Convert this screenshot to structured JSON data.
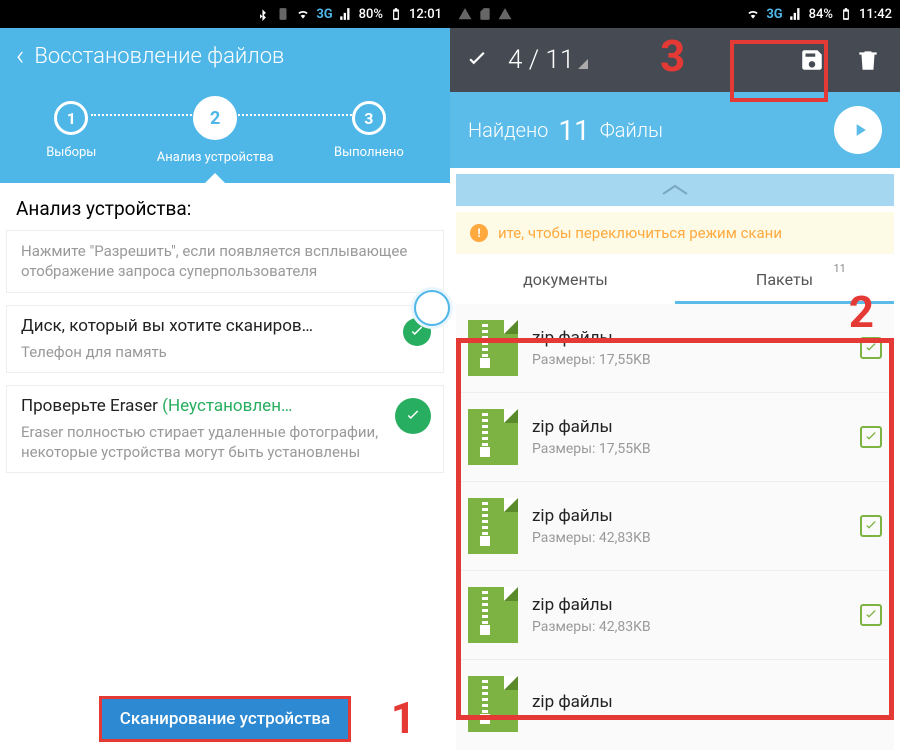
{
  "screenA": {
    "status": {
      "network": "3G",
      "battery": "80%",
      "time": "12:01"
    },
    "title": "Восстановление файлов",
    "steps": [
      {
        "num": "1",
        "label": "Выборы"
      },
      {
        "num": "2",
        "label": "Анализ устройства"
      },
      {
        "num": "3",
        "label": "Выполнено"
      }
    ],
    "section_title": "Анализ устройства:",
    "card1": {
      "instructions": "Нажмите \"Разрешить\", если появляется всплывающее отображение запроса суперпользователя"
    },
    "card2": {
      "title": "Диск, который вы хотите сканиров…",
      "subtitle": "Телефон для память"
    },
    "card3": {
      "title_pre": "Проверьте Eraser ",
      "title_status": "(Неустановлен…",
      "subtitle": "Eraser полностью стирает удаленные фотографии, некоторые устройства могут быть установлены"
    },
    "scan_button": "Сканирование устройства"
  },
  "screenB": {
    "status": {
      "network": "3G",
      "battery": "84%",
      "time": "11:42"
    },
    "selection": "4 / 11",
    "found": {
      "prefix": "Найдено",
      "count": "11",
      "suffix": "Файлы"
    },
    "banner": "ите, чтобы переключиться режим скани",
    "tabs": [
      {
        "label": "документы",
        "badge": ""
      },
      {
        "label": "Пакеты",
        "badge": "11"
      }
    ],
    "items": [
      {
        "name": "zip файлы",
        "size": "Размеры: 17,55KB"
      },
      {
        "name": "zip файлы",
        "size": "Размеры: 17,55KB"
      },
      {
        "name": "zip файлы",
        "size": "Размеры: 42,83KB"
      },
      {
        "name": "zip файлы",
        "size": "Размеры: 42,83KB"
      },
      {
        "name": "zip файлы",
        "size": ""
      }
    ]
  },
  "annotations": {
    "a1": "1",
    "a2": "2",
    "a3": "3"
  }
}
